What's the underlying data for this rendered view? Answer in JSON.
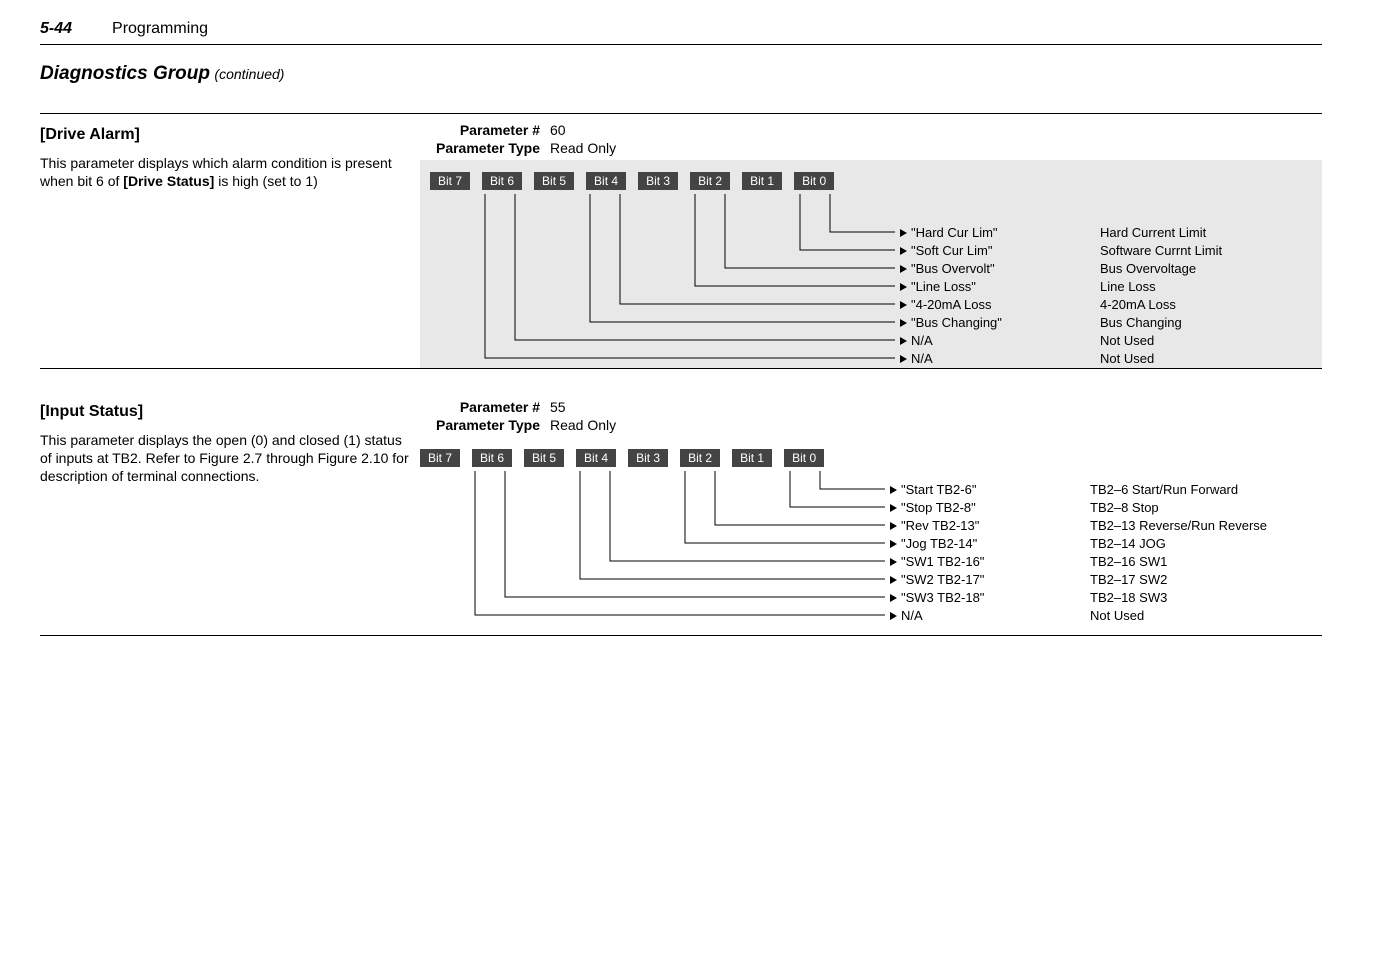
{
  "header": {
    "page_number": "5-44",
    "chapter": "Programming"
  },
  "group_title": "Diagnostics Group",
  "group_continued": "(continued)",
  "sections": [
    {
      "name": "[Drive Alarm]",
      "description_prefix": "This parameter displays which alarm condition is present when bit 6 of ",
      "description_bold": "[Drive Status]",
      "description_suffix": " is high (set to 1)",
      "param_num_label": "Parameter #",
      "param_num_value": "60",
      "param_type_label": "Parameter Type",
      "param_type_value": "Read Only",
      "bits": [
        "Bit 7",
        "Bit 6",
        "Bit 5",
        "Bit 4",
        "Bit 3",
        "Bit 2",
        "Bit 1",
        "Bit 0"
      ],
      "rows": [
        {
          "name": "\"Hard Cur Lim\"",
          "desc": "Hard Current Limit"
        },
        {
          "name": "\"Soft Cur Lim\"",
          "desc": "Software Currnt Limit"
        },
        {
          "name": "\"Bus Overvolt\"",
          "desc": "Bus Overvoltage"
        },
        {
          "name": "\"Line Loss\"",
          "desc": "Line Loss"
        },
        {
          "name": "\"4-20mA Loss",
          "desc": "4-20mA Loss"
        },
        {
          "name": "\"Bus Changing\"",
          "desc": "Bus Changing"
        },
        {
          "name": "N/A",
          "desc": "Not Used"
        },
        {
          "name": "N/A",
          "desc": "Not Used"
        }
      ]
    },
    {
      "name": "[Input Status]",
      "description": "This parameter displays the open (0) and closed (1) status of inputs at TB2.  Refer to Figure 2.7 through Figure 2.10 for description of terminal connections.",
      "param_num_label": "Parameter #",
      "param_num_value": "55",
      "param_type_label": "Parameter Type",
      "param_type_value": "Read Only",
      "bits": [
        "Bit 7",
        "Bit 6",
        "Bit 5",
        "Bit 4",
        "Bit 3",
        "Bit 2",
        "Bit 1",
        "Bit 0"
      ],
      "rows": [
        {
          "name": "\"Start TB2-6\"",
          "desc": "TB2–6  Start/Run Forward"
        },
        {
          "name": "\"Stop TB2-8\"",
          "desc": "TB2–8  Stop"
        },
        {
          "name": "\"Rev TB2-13\"",
          "desc": "TB2–13  Reverse/Run Reverse"
        },
        {
          "name": "\"Jog TB2-14\"",
          "desc": "TB2–14  JOG"
        },
        {
          "name": "\"SW1 TB2-16\"",
          "desc": "TB2–16  SW1"
        },
        {
          "name": "\"SW2 TB2-17\"",
          "desc": "TB2–17  SW2"
        },
        {
          "name": "\"SW3 TB2-18\"",
          "desc": "TB2–18  SW3"
        },
        {
          "name": "N/A",
          "desc": "Not Used"
        }
      ]
    }
  ]
}
